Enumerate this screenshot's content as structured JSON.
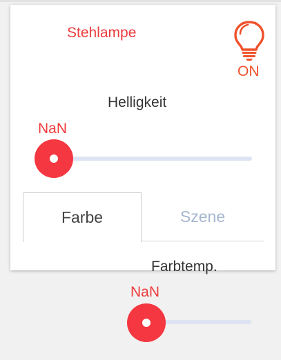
{
  "device": {
    "name": "Stehlampe",
    "state": "ON",
    "icon": "lightbulb-icon"
  },
  "brightness": {
    "title": "Helligkeit",
    "value_text": "NaN",
    "level": 0
  },
  "tabs": [
    {
      "label": "Farbe",
      "active": true
    },
    {
      "label": "Szene",
      "active": false
    }
  ],
  "color_temperature": {
    "title": "Farbtemp.",
    "value_text": "NaN",
    "level": 0
  },
  "colors": {
    "accent": "#ee3b3b",
    "bulb_outline": "#f0512b",
    "track": "#dde3f3",
    "inactive_tab": "#a6b6cf"
  }
}
